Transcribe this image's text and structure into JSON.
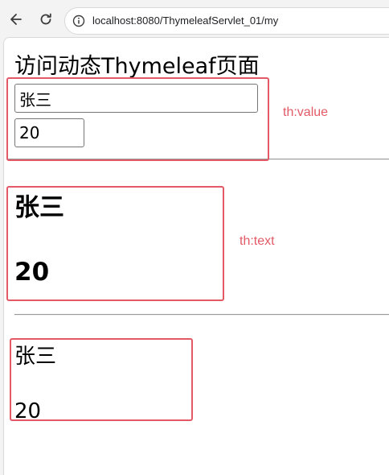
{
  "browser": {
    "url": "localhost:8080/ThymeleafServlet_01/my"
  },
  "page": {
    "title": "访问动态Thymeleaf页面",
    "value_section": {
      "name_value": "张三",
      "age_value": "20"
    },
    "text_section": {
      "name": "张三",
      "age": "20"
    },
    "plain_section": {
      "name": "张三",
      "age": "20"
    }
  },
  "annotations": {
    "value_label": "th:value",
    "text_label": "th:text",
    "color": "#e35a66"
  },
  "icons": [
    "back-arrow-icon",
    "reload-icon",
    "info-icon"
  ]
}
